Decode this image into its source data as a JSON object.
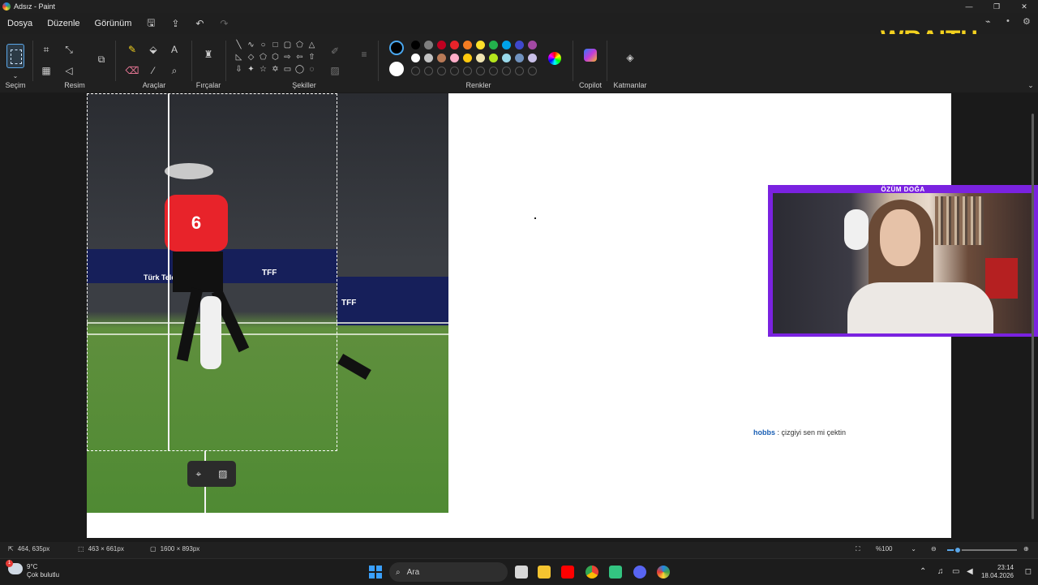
{
  "window": {
    "title": "Adsız - Paint",
    "controls": [
      "—",
      "❐",
      "✕"
    ]
  },
  "menu": {
    "file": "Dosya",
    "edit": "Düzenle",
    "view": "Görünüm"
  },
  "ribbon": {
    "selection_label": "Seçim",
    "image_label": "Resim",
    "tools_label": "Araçlar",
    "brushes_label": "Fırçalar",
    "shapes_label": "Şekiller",
    "colors_label": "Renkler",
    "copilot_label": "Copilot",
    "layers_label": "Katmanlar",
    "color1": "#000000",
    "color2": "#ffffff",
    "palette_row1": [
      "#000000",
      "#7f7f7f",
      "#c00020",
      "#e8232a",
      "#f57c22",
      "#fde02a",
      "#23b14c",
      "#00a2e8",
      "#3f48cc",
      "#a349a4"
    ],
    "palette_row2": [
      "#ffffff",
      "#c3c3c3",
      "#b97a57",
      "#ffaec9",
      "#ffc90e",
      "#efe4b0",
      "#b5e61d",
      "#99d9ea",
      "#7092be",
      "#c8bfe7"
    ]
  },
  "overlay": {
    "brand": "WRAITH",
    "streamer_name": "ÖZÜM DOĞA",
    "chat_user": "hobbs",
    "chat_message": ": çizgiyi sen mi çektin"
  },
  "photo": {
    "banner_text_1": "TFF",
    "banner_text_2": "Türk Telekom",
    "banner_text_3": "TFF",
    "player_number": "6"
  },
  "status": {
    "cursor_pos": "464, 635px",
    "selection_size": "463 × 661px",
    "canvas_size": "1600 × 893px",
    "zoom": "%100"
  },
  "taskbar": {
    "temperature": "9°C",
    "weather": "Çok bulutlu",
    "weather_badge": "1",
    "search_placeholder": "Ara",
    "time": "23:14",
    "date": "18.04.2026"
  }
}
